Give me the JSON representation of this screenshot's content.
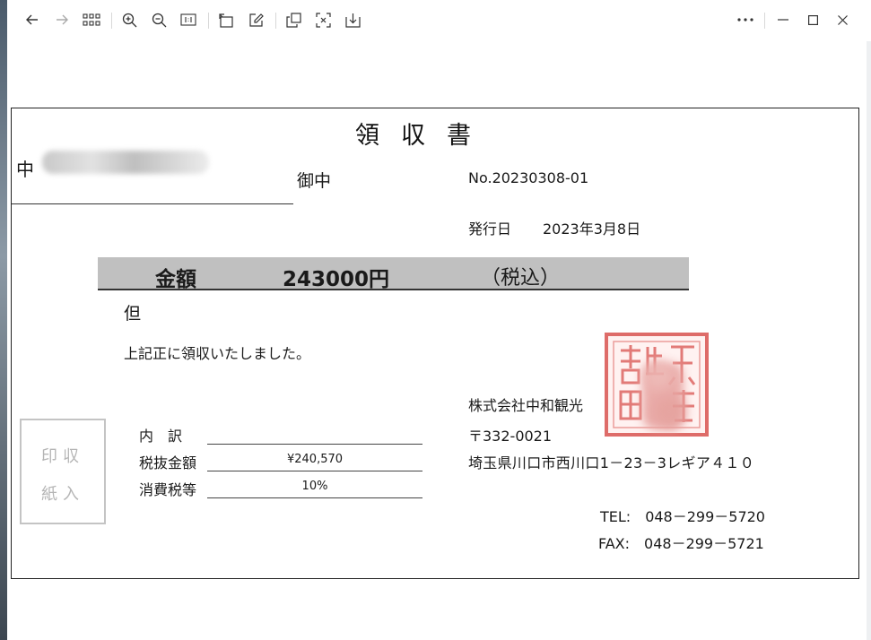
{
  "toolbar": {
    "icons": [
      "back-icon",
      "forward-icon",
      "grid-icon",
      "zoom-in-icon",
      "zoom-out-icon",
      "actual-size-icon",
      "rotate-icon",
      "edit-icon",
      "copy-icon",
      "ocr-icon",
      "download-icon",
      "more-icon",
      "minimize-icon",
      "maximize-icon",
      "close-icon"
    ]
  },
  "receipt": {
    "title": "領収書",
    "recipient_visible": "中",
    "honorific": "御中",
    "receipt_no": "No.20230308-01",
    "issue_label": "発行日",
    "issue_date": "2023年3月8日",
    "amount_label": "金額",
    "amount_value": "243000円",
    "tax_included": "（税込）",
    "proviso": "但",
    "received_text": "上記正に領収いたしました。",
    "stamp_box": {
      "line1": "印収",
      "line2": "紙入"
    },
    "breakdown": {
      "label_breakdown": "内　訳",
      "label_pretax": "税抜金額",
      "pretax_value": "¥240,570",
      "label_tax": "消費税等",
      "tax_value": "10%"
    },
    "issuer": {
      "company": "株式会社中和観光",
      "postal": "〒332-0021",
      "address": "埼玉県川口市西川口1－23－3レギア４１０",
      "tel": "TEL:　048－299－5720",
      "fax": "FAX:　048－299－5721"
    }
  },
  "colors": {
    "amount_bar": "#c0c0c0",
    "seal_red": "#d9534f",
    "stamp_box_border": "#c4c4c4"
  }
}
